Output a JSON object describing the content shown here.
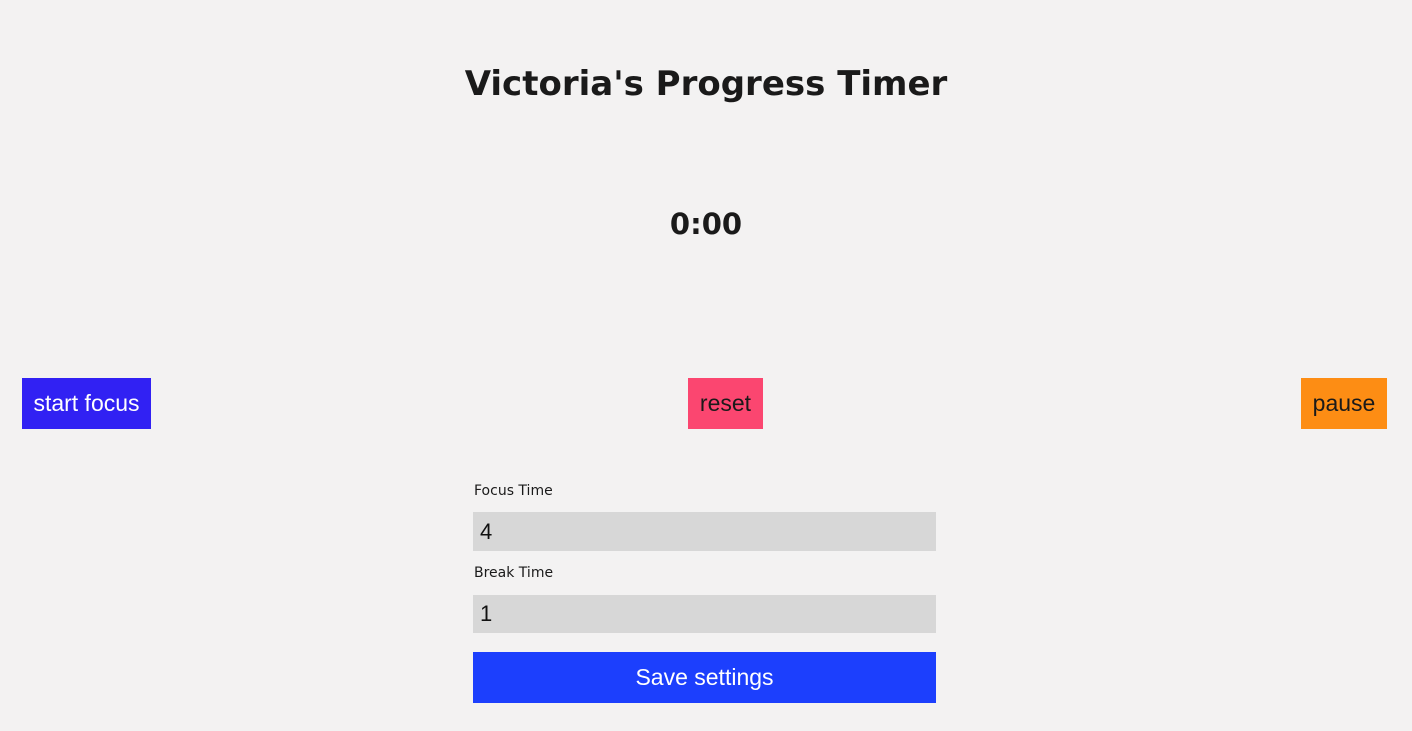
{
  "header": {
    "title": "Victoria's Progress Timer"
  },
  "timer": {
    "display": "0:00"
  },
  "controls": {
    "start_label": "start focus",
    "reset_label": "reset",
    "pause_label": "pause"
  },
  "settings": {
    "focus_label": "Focus Time",
    "focus_value": "4",
    "break_label": "Break Time",
    "break_value": "1",
    "save_label": "Save settings"
  },
  "colors": {
    "background": "#f3f2f2",
    "start_button": "#3121f3",
    "reset_button": "#fb4670",
    "pause_button": "#fd8d14",
    "save_button": "#1c3ffd",
    "input_background": "#d7d7d7"
  }
}
